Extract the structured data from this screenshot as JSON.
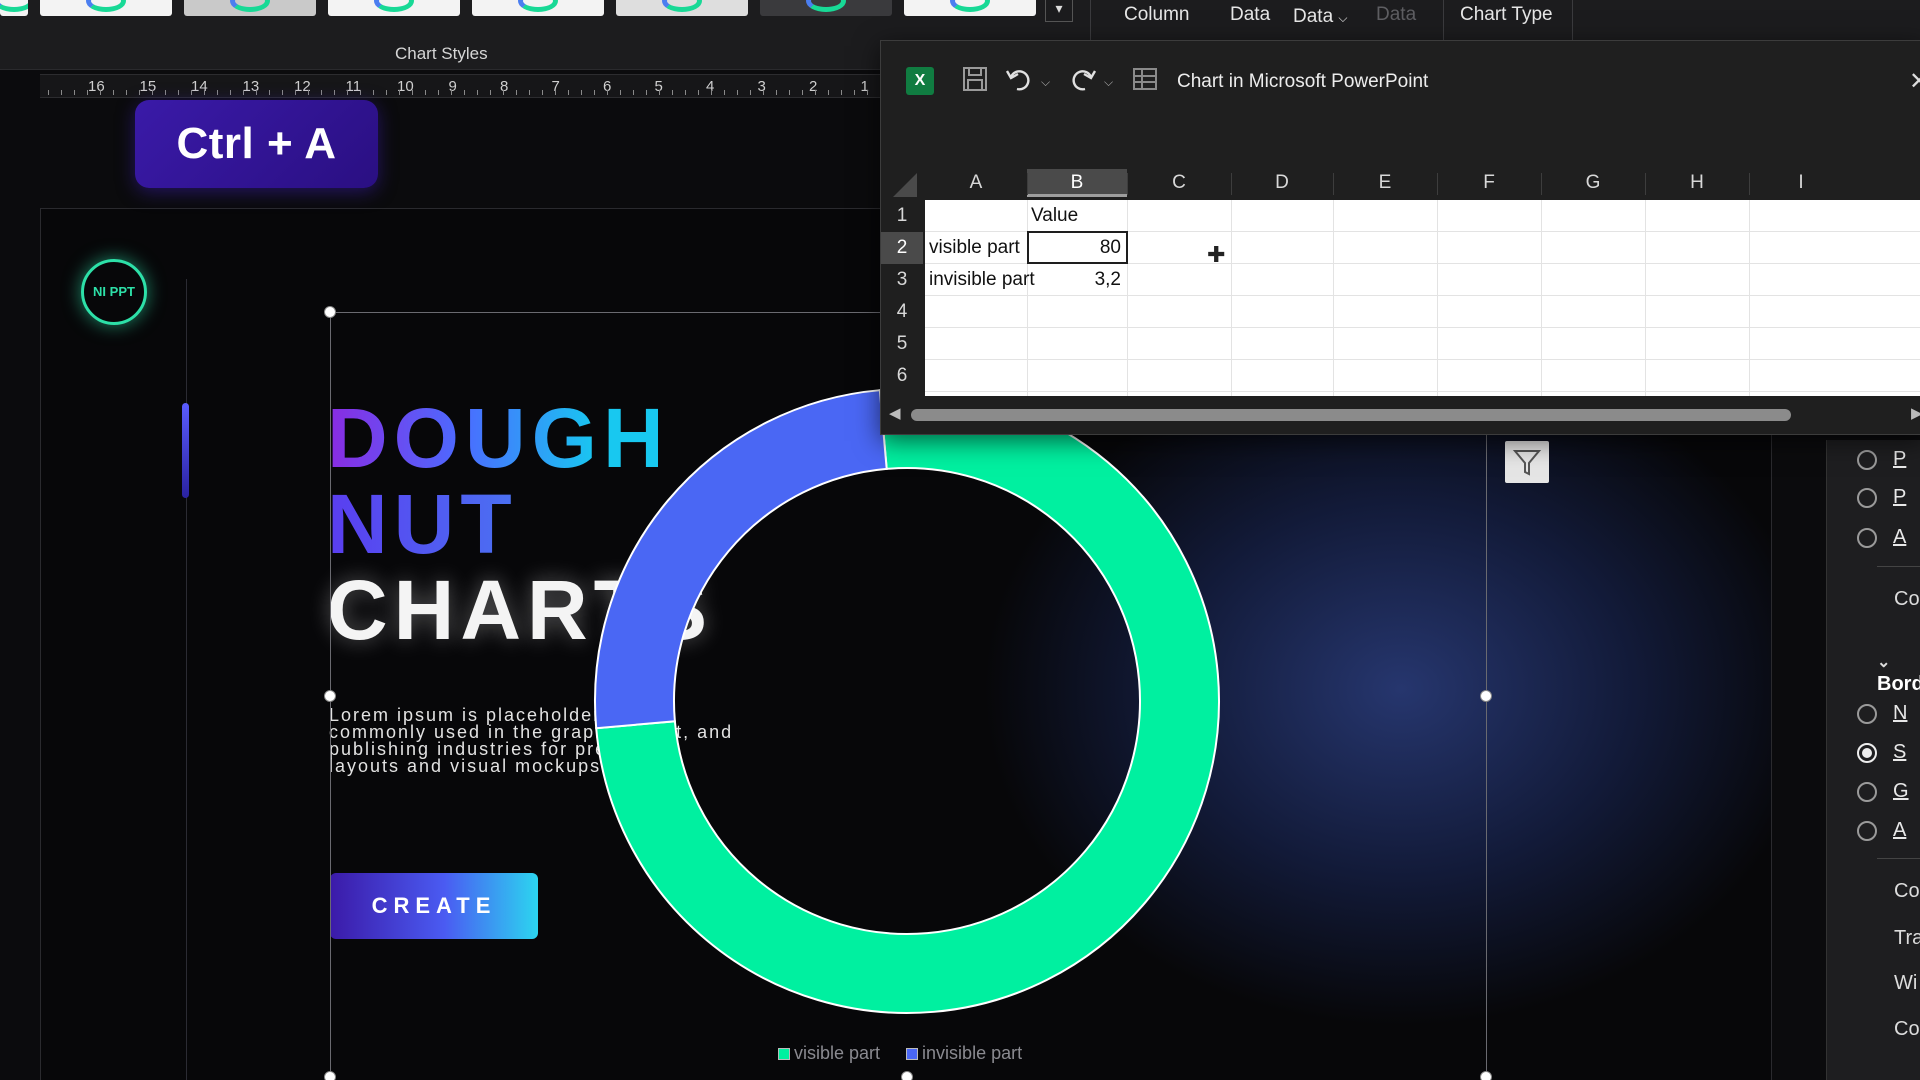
{
  "ribbon": {
    "chart_styles_label": "Chart Styles",
    "more_glyph": "▾",
    "items": {
      "column": "Column",
      "data": "Data",
      "data_dropdown": "Data",
      "data_dim": "Data",
      "chart_type": "Chart Type"
    }
  },
  "ruler": {
    "numbers": [
      "16",
      "15",
      "14",
      "13",
      "12",
      "11",
      "10",
      "9",
      "8",
      "7",
      "6",
      "5",
      "4",
      "3",
      "2",
      "1"
    ]
  },
  "keyboard_overlay": {
    "shortcut": "Ctrl + A"
  },
  "slide": {
    "logo_text": "NI PPT",
    "title": {
      "line1": "DOUGH",
      "line2": "NUT",
      "line3": "CHARTS"
    },
    "body": "Lorem ipsum is placeholder text commonly used in the graphic, print, and publishing industries for previewing layouts and visual mockups.",
    "button": "CREATE",
    "filter_icon": "filter-icon"
  },
  "chart_data": {
    "type": "pie",
    "subtype": "doughnut",
    "categories": [
      "visible part",
      "invisible part"
    ],
    "values": [
      80,
      3.2
    ],
    "colors": [
      "#00f0a0",
      "#4a67f4"
    ],
    "legend": "bottom"
  },
  "legend": {
    "items": [
      {
        "label": "visible part",
        "color": "#00f0a0"
      },
      {
        "label": "invisible part",
        "color": "#4a67f4"
      }
    ]
  },
  "excel": {
    "app_icon": "excel-icon",
    "caption": "Chart in Microsoft PowerPoint",
    "close_glyph": "✕",
    "columns": [
      "A",
      "B",
      "C",
      "D",
      "E",
      "F",
      "G",
      "H",
      "I"
    ],
    "active_column": "B",
    "rows": [
      "1",
      "2",
      "3",
      "4",
      "5",
      "6"
    ],
    "active_row": "2",
    "cells": {
      "B1": "Value",
      "A2": "visible part",
      "B2": "80",
      "A3": "invisible part",
      "B3": "3,2"
    }
  },
  "format_pane": {
    "section": "Bord",
    "labels_top": [
      "P",
      "P",
      "A"
    ],
    "col_text_1": "Co",
    "labels_border": [
      "N",
      "S",
      "G",
      "A"
    ],
    "selected_border_index": 1,
    "bottom_texts": [
      "Co",
      "Tra",
      "Wi",
      "Co"
    ]
  },
  "colors": {
    "accent_teal": "#00f0a0",
    "accent_blue": "#4a67f4",
    "keycap": "#3a1aa8",
    "excel_green": "#107c41"
  }
}
